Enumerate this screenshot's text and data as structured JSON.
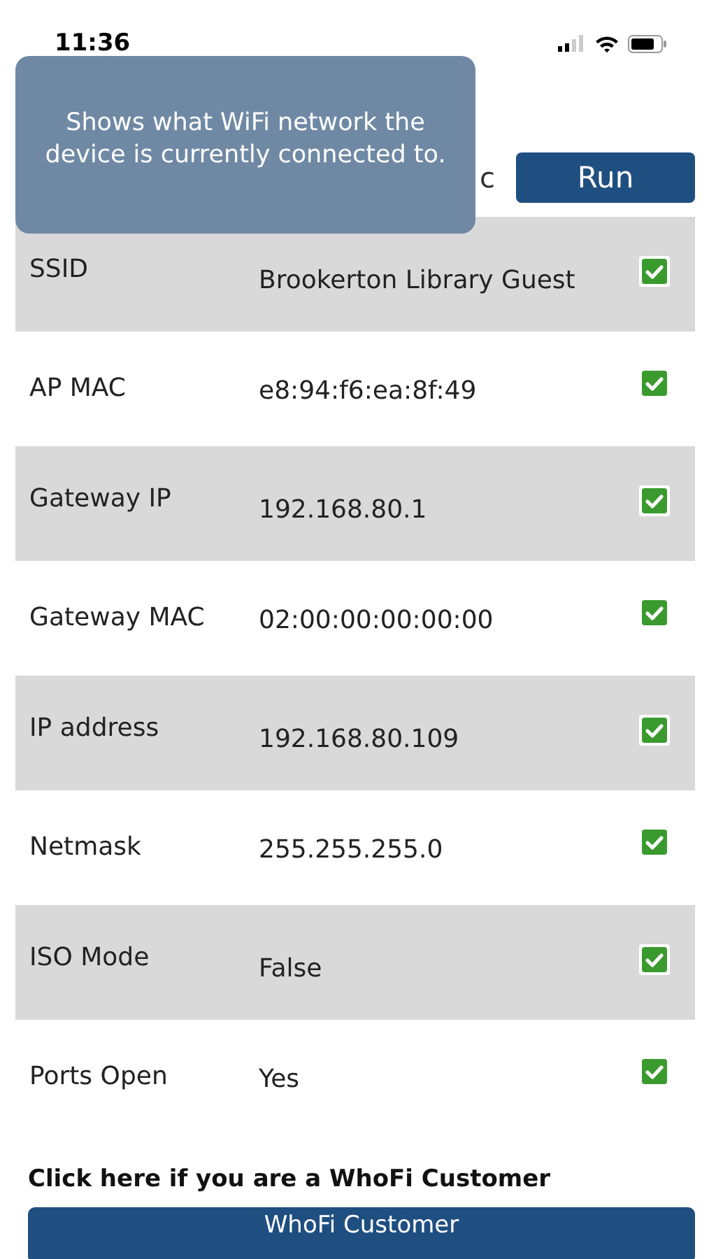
{
  "status_bar": {
    "time": "11:36"
  },
  "header": {
    "title": "c",
    "run_button": "Run"
  },
  "tooltip": {
    "text": "Shows what WiFi network the device is currently connected to."
  },
  "rows": [
    {
      "label": "SSID",
      "value": "Brookerton Library Guest",
      "checked": true
    },
    {
      "label": "AP MAC",
      "value": "e8:94:f6:ea:8f:49",
      "checked": true
    },
    {
      "label": "Gateway IP",
      "value": "192.168.80.1",
      "checked": true
    },
    {
      "label": "Gateway MAC",
      "value": "02:00:00:00:00:00",
      "checked": true
    },
    {
      "label": "IP address",
      "value": "192.168.80.109",
      "checked": true
    },
    {
      "label": "Netmask",
      "value": "255.255.255.0",
      "checked": true
    },
    {
      "label": "ISO Mode",
      "value": "False",
      "checked": true
    },
    {
      "label": "Ports Open",
      "value": "Yes",
      "checked": true
    }
  ],
  "customer": {
    "prompt": "Click here if you are a WhoFi Customer",
    "button": "WhoFi Customer"
  }
}
